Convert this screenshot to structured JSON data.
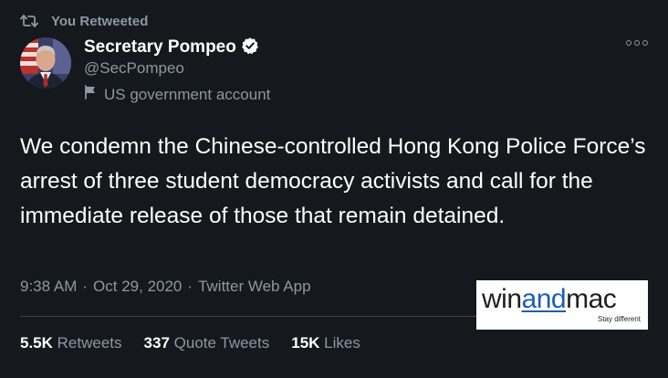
{
  "retweet_banner": {
    "label": "You Retweeted"
  },
  "user": {
    "display_name": "Secretary Pompeo",
    "handle": "@SecPompeo",
    "label": "US government account"
  },
  "tweet": {
    "text": "We condemn the Chinese-controlled Hong Kong Police Force’s arrest of three student democracy activists and call for the immediate release of those that remain detained.",
    "time": "9:38 AM",
    "date": "Oct 29, 2020",
    "source": "Twitter Web App",
    "separator": "·"
  },
  "stats": {
    "retweets": {
      "count": "5.5K",
      "label": "Retweets"
    },
    "quote_tweets": {
      "count": "337",
      "label": "Quote Tweets"
    },
    "likes": {
      "count": "15K",
      "label": "Likes"
    }
  },
  "watermark": {
    "part1": "win",
    "part2": "and",
    "part3": "mac",
    "tagline": "Stay different"
  },
  "colors": {
    "background": "#15181c",
    "muted_text": "#8b98a5",
    "verified_badge": "#ffffff",
    "divider": "#38444d"
  },
  "icons": {
    "retweet": "retweet-icon",
    "verified": "verified-badge-icon",
    "flag": "flag-icon",
    "more": "more-options-icon"
  }
}
